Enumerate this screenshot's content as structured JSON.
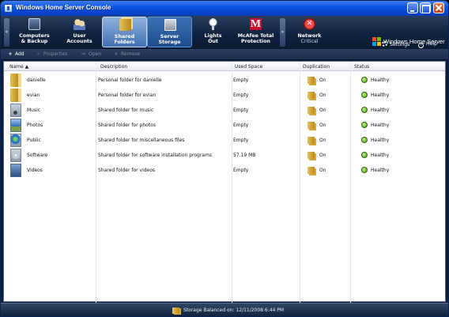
{
  "window": {
    "title": "Windows Home Server Console"
  },
  "nav": {
    "tabs": [
      {
        "label": "Computers\n& Backup",
        "icon": "computers-icon"
      },
      {
        "label": "User\nAccounts",
        "icon": "users-icon"
      },
      {
        "label": "Shared\nFolders",
        "icon": "shared-folders-icon",
        "selected": true
      },
      {
        "label": "Server\nStorage",
        "icon": "server-storage-icon"
      },
      {
        "label": "Lights\nOut",
        "icon": "lights-out-icon"
      },
      {
        "label": "McAfee Total\nProtection",
        "icon": "mcafee-icon"
      },
      {
        "label": "Network",
        "sub": "Critical",
        "icon": "network-critical-icon"
      }
    ],
    "mcafee_glyph": "M",
    "network_glyph": "✕",
    "scroll_left": "«",
    "scroll_right": "»"
  },
  "header": {
    "brand": "Windows Home Server",
    "settings_label": "Settings",
    "help_label": "Help",
    "help_glyph": "?"
  },
  "toolbar": {
    "add": {
      "glyph": "+",
      "label": "Add",
      "enabled": true
    },
    "properties": {
      "glyph": "✓",
      "label": "Properties",
      "enabled": false
    },
    "open": {
      "glyph": "⇨",
      "label": "Open",
      "enabled": false
    },
    "remove": {
      "glyph": "✕",
      "label": "Remove",
      "enabled": false
    }
  },
  "list": {
    "columns": [
      "Name ▲",
      "Description",
      "Used Space",
      "Duplication",
      "Status"
    ],
    "rows": [
      {
        "name": "danielle",
        "description": "Personal folder for danielle",
        "used": "Empty",
        "duplication": "On",
        "status": "Healthy",
        "icon": "user-folder-icon"
      },
      {
        "name": "evian",
        "description": "Personal folder for evian",
        "used": "Empty",
        "duplication": "On",
        "status": "Healthy",
        "icon": "user-folder-icon"
      },
      {
        "name": "Music",
        "description": "Shared folder for music",
        "used": "Empty",
        "duplication": "On",
        "status": "Healthy",
        "icon": "music-folder-icon"
      },
      {
        "name": "Photos",
        "description": "Shared folder for photos",
        "used": "Empty",
        "duplication": "On",
        "status": "Healthy",
        "icon": "photos-folder-icon"
      },
      {
        "name": "Public",
        "description": "Shared folder for miscellaneous files",
        "used": "Empty",
        "duplication": "On",
        "status": "Healthy",
        "icon": "public-folder-icon"
      },
      {
        "name": "Software",
        "description": "Shared folder for software installation programs",
        "used": "57.19 MB",
        "duplication": "On",
        "status": "Healthy",
        "icon": "software-folder-icon"
      },
      {
        "name": "Videos",
        "description": "Shared folder for videos",
        "used": "Empty",
        "duplication": "On",
        "status": "Healthy",
        "icon": "videos-folder-icon"
      }
    ]
  },
  "statusbar": {
    "text": "Storage Balanced on: 12/11/2008 6:44 PM"
  }
}
